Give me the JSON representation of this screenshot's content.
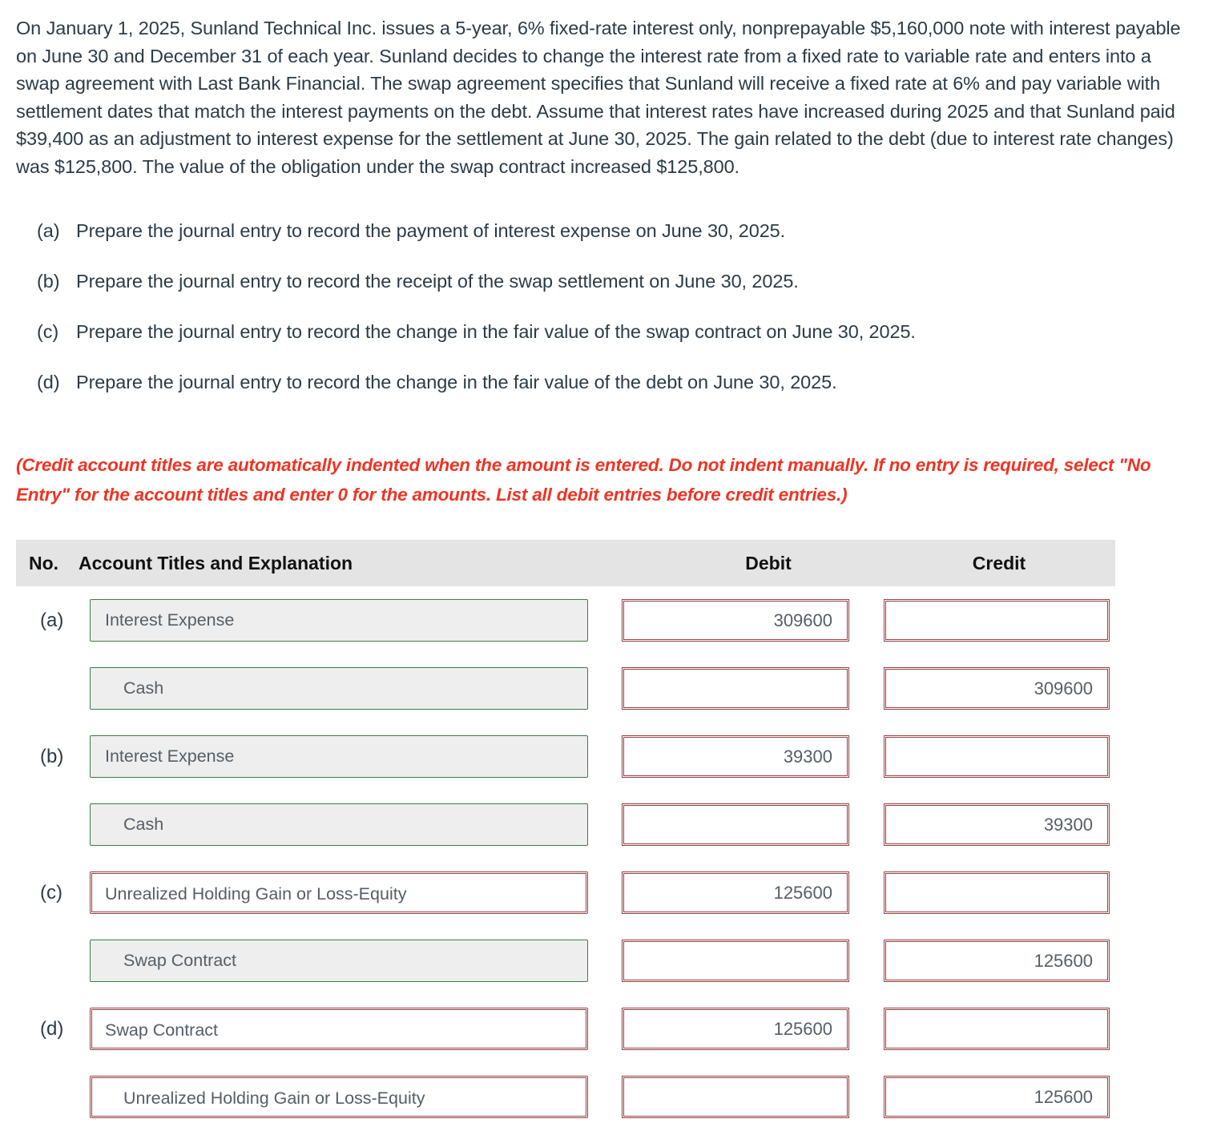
{
  "problem": {
    "text": "On January 1, 2025, Sunland Technical Inc. issues a 5-year, 6% fixed-rate interest only, nonprepayable $5,160,000 note with interest payable on June 30 and December 31 of each year. Sunland decides to change the interest rate from a fixed rate to variable rate and enters into a swap agreement with Last Bank Financial. The swap agreement specifies that Sunland will receive a fixed rate at 6% and pay variable with settlement dates that match the interest payments on the debt. Assume that interest rates have increased during 2025 and that Sunland paid $39,400 as an adjustment to interest expense for the settlement at June 30, 2025. The gain related to the debt (due to interest rate changes) was $125,800. The value of the obligation under the swap contract increased $125,800."
  },
  "requirements": [
    {
      "label": "(a)",
      "text": "Prepare the journal entry to record the payment of interest expense on June 30, 2025."
    },
    {
      "label": "(b)",
      "text": "Prepare the journal entry to record the receipt of the swap settlement on June 30, 2025."
    },
    {
      "label": "(c)",
      "text": "Prepare the journal entry to record the change in the fair value of the swap contract on June 30, 2025."
    },
    {
      "label": "(d)",
      "text": "Prepare the journal entry to record the change in the fair value of the debt on June 30, 2025."
    }
  ],
  "instructions": {
    "text": "(Credit account titles are automatically indented when the amount is entered. Do not indent manually. If no entry is required, select \"No Entry\" for the account titles and enter 0 for the amounts. List all debit entries before credit entries.)",
    "color": "#f03323"
  },
  "journal": {
    "headers": {
      "no": "No.",
      "account": "Account Titles and Explanation",
      "debit": "Debit",
      "credit": "Credit"
    },
    "rows": [
      {
        "no": "(a)",
        "account": "Interest Expense",
        "debit": "309600",
        "credit": "",
        "indented": false,
        "style": "filled"
      },
      {
        "no": "",
        "account": "Cash",
        "debit": "",
        "credit": "309600",
        "indented": true,
        "style": "filled"
      },
      {
        "no": "(b)",
        "account": "Interest Expense",
        "debit": "39300",
        "credit": "",
        "indented": false,
        "style": "filled"
      },
      {
        "no": "",
        "account": "Cash",
        "debit": "",
        "credit": "39300",
        "indented": true,
        "style": "filled"
      },
      {
        "no": "(c)",
        "account": "Unrealized Holding Gain or Loss-Equity",
        "debit": "125600",
        "credit": "",
        "indented": false,
        "style": "outlined"
      },
      {
        "no": "",
        "account": "Swap Contract",
        "debit": "",
        "credit": "125600",
        "indented": true,
        "style": "filled"
      },
      {
        "no": "(d)",
        "account": "Swap Contract",
        "debit": "125600",
        "credit": "",
        "indented": false,
        "style": "outlined"
      },
      {
        "no": "",
        "account": "Unrealized Holding Gain or Loss-Equity",
        "debit": "",
        "credit": "125600",
        "indented": true,
        "style": "outlined"
      }
    ]
  }
}
